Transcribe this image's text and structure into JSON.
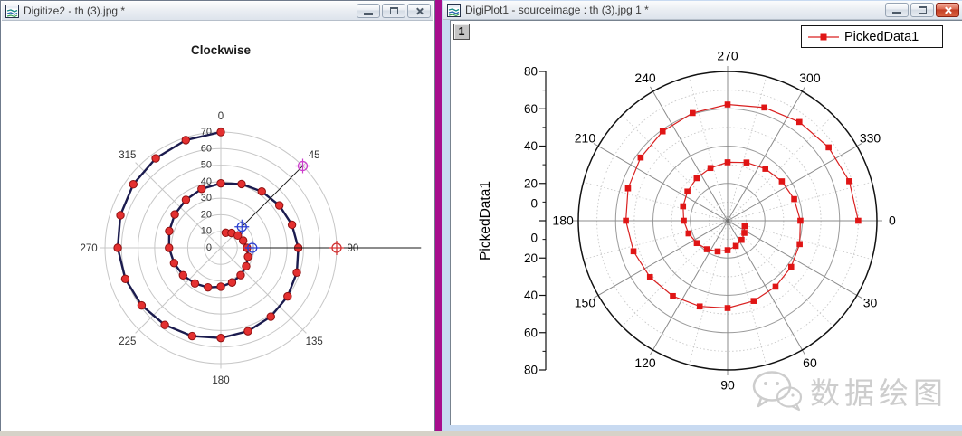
{
  "left_window": {
    "title": "Digitize2 - th (3).jpg *",
    "icon": "origin-graph-window-icon",
    "controls": [
      "minimize",
      "maximize",
      "close"
    ]
  },
  "right_window": {
    "title": "DigiPlot1 - sourceimage : th (3).jpg 1 *",
    "icon": "origin-graph-window-icon",
    "layer_button_label": "1",
    "controls": [
      "minimize",
      "maximize",
      "close"
    ],
    "legend": "PickedData1",
    "y_axis_title": "PickedData1"
  },
  "watermark": {
    "icon": "wechat-icon",
    "text": "数据绘图"
  },
  "colors": {
    "divider": "#a70d8d",
    "frame_blue": "#c8daf1",
    "spiral_line": "#1b1b4e",
    "spiral_marker": "#e43030",
    "picked_line": "#d92020",
    "picked_marker": "#e01515",
    "calib_blue": "#2b3fd0",
    "calib_magenta": "#cc3ecc",
    "calib_red": "#d03030"
  },
  "chart_data": [
    {
      "id": "digitize-preview",
      "type": "line",
      "subtype": "polar-spiral",
      "title": "Clockwise",
      "orientation": {
        "zero_at": "top",
        "direction": "clockwise"
      },
      "angle_unit": "degrees",
      "angle_tick_values": [
        0,
        45,
        90,
        135,
        180,
        225,
        270,
        315
      ],
      "angle_tick_labels": [
        "0",
        "45",
        "90",
        "135",
        "180",
        "225",
        "270",
        "315"
      ],
      "radial_tick_values": [
        0,
        10,
        20,
        30,
        40,
        50,
        60,
        70
      ],
      "rmax": 70,
      "grid": {
        "circle_step": 10,
        "spoke_step_deg": 45
      },
      "series": [
        {
          "name": "digitized-spiral",
          "marker": "circle",
          "line_color": "#1b1b4e",
          "marker_color": "#e43030",
          "marker_edge": "#8f1010",
          "points_format": "[total_angle_deg, r]",
          "points": [
            [
              18,
              9.6
            ],
            [
              36,
              11.1
            ],
            [
              54,
              12.7
            ],
            [
              72,
              14.2
            ],
            [
              90,
              15.8
            ],
            [
              108,
              17.3
            ],
            [
              126,
              18.9
            ],
            [
              144,
              20.4
            ],
            [
              162,
              22.0
            ],
            [
              180,
              23.5
            ],
            [
              198,
              25.1
            ],
            [
              216,
              26.6
            ],
            [
              234,
              28.2
            ],
            [
              252,
              29.7
            ],
            [
              270,
              31.3
            ],
            [
              288,
              32.8
            ],
            [
              306,
              34.4
            ],
            [
              324,
              35.9
            ],
            [
              342,
              37.5
            ],
            [
              360,
              39.0
            ],
            [
              378,
              40.6
            ],
            [
              396,
              42.1
            ],
            [
              414,
              43.7
            ],
            [
              432,
              45.2
            ],
            [
              450,
              46.8
            ],
            [
              468,
              48.3
            ],
            [
              486,
              49.9
            ],
            [
              504,
              51.4
            ],
            [
              522,
              53.0
            ],
            [
              540,
              54.5
            ],
            [
              558,
              56.1
            ],
            [
              576,
              57.6
            ],
            [
              594,
              59.2
            ],
            [
              612,
              60.7
            ],
            [
              630,
              62.3
            ],
            [
              648,
              63.8
            ],
            [
              666,
              65.4
            ],
            [
              684,
              66.9
            ],
            [
              702,
              68.5
            ],
            [
              720,
              70.0
            ]
          ]
        }
      ],
      "calibration": {
        "markers": [
          {
            "name": "angle-ref-45",
            "color": "#cc3ecc",
            "angle": 45,
            "r": 70,
            "at_label": "45"
          },
          {
            "name": "angle-ref-90",
            "color": "#d03030",
            "angle": 90,
            "r": 70,
            "at_label": "90"
          },
          {
            "name": "origin-ref-45",
            "color": "#2b3fd0",
            "angle": 45,
            "r": 18
          },
          {
            "name": "origin-ref-90",
            "color": "#2b3fd0",
            "angle": 90,
            "r": 19
          }
        ],
        "lines": [
          {
            "angle": 45,
            "r_from": 18,
            "r_to": 70
          },
          {
            "angle": 90,
            "r_from": 19,
            "r_to": 121
          }
        ]
      }
    },
    {
      "id": "digiplot",
      "type": "line",
      "subtype": "polar-scatter-line",
      "legend": [
        "PickedData1"
      ],
      "ylabel": "PickedData1",
      "orientation": {
        "zero_at": "right",
        "direction": "clockwise"
      },
      "angle_unit": "degrees",
      "angle_tick_values": [
        0,
        30,
        60,
        90,
        120,
        150,
        180,
        210,
        240,
        270,
        300,
        330
      ],
      "angle_tick_labels": [
        "0",
        "30",
        "60",
        "90",
        "120",
        "150",
        "180",
        "210",
        "240",
        "270",
        "300",
        "330"
      ],
      "radial_axis_labels": [
        "80",
        "60",
        "40",
        "20",
        "0",
        "0",
        "20",
        "40",
        "60",
        "80"
      ],
      "rmax": 80,
      "grid": {
        "major_circle_step": 20,
        "minor_circle_step": 10,
        "major_spoke_step_deg": 30,
        "minor_spoke_step_deg": 15
      },
      "series": [
        {
          "name": "PickedData1",
          "marker": "square",
          "line_color": "#d92020",
          "marker_color": "#e01515",
          "points_format": "[total_angle_deg, r]",
          "points": [
            [
              18,
              9.6
            ],
            [
              36,
              11.1
            ],
            [
              54,
              12.7
            ],
            [
              72,
              14.2
            ],
            [
              90,
              15.8
            ],
            [
              108,
              17.3
            ],
            [
              126,
              18.9
            ],
            [
              144,
              20.4
            ],
            [
              162,
              22.0
            ],
            [
              180,
              23.5
            ],
            [
              198,
              25.1
            ],
            [
              216,
              26.6
            ],
            [
              234,
              28.2
            ],
            [
              252,
              29.7
            ],
            [
              270,
              31.3
            ],
            [
              288,
              32.8
            ],
            [
              306,
              34.4
            ],
            [
              324,
              35.9
            ],
            [
              342,
              37.5
            ],
            [
              360,
              39.0
            ],
            [
              378,
              40.6
            ],
            [
              396,
              42.1
            ],
            [
              414,
              43.7
            ],
            [
              432,
              45.2
            ],
            [
              450,
              46.8
            ],
            [
              468,
              48.3
            ],
            [
              486,
              49.9
            ],
            [
              504,
              51.4
            ],
            [
              522,
              53.0
            ],
            [
              540,
              54.5
            ],
            [
              558,
              56.1
            ],
            [
              576,
              57.6
            ],
            [
              594,
              59.2
            ],
            [
              612,
              60.7
            ],
            [
              630,
              62.3
            ],
            [
              648,
              63.8
            ],
            [
              666,
              65.4
            ],
            [
              684,
              66.9
            ],
            [
              702,
              68.5
            ],
            [
              720,
              70.0
            ]
          ]
        }
      ]
    }
  ]
}
